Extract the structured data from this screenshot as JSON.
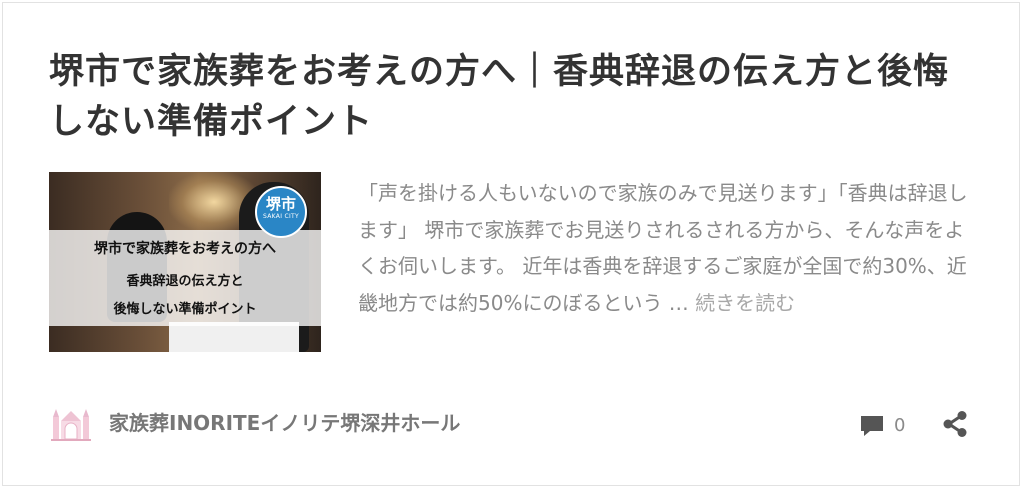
{
  "post": {
    "title": "堺市で家族葬をお考えの方へ｜香典辞退の伝え方と後悔しない準備ポイント",
    "thumbnail": {
      "line1": "堺市で家族葬をお考えの方へ",
      "line2": "香典辞退の伝え方と",
      "line3": "後悔しない準備ポイント",
      "badge_main": "堺市",
      "badge_sub": "SAKAI CITY"
    },
    "excerpt": "「声を掛ける人もいないので家族のみで見送ります」「香典は辞退します」 堺市で家族葬でお見送りされるされる方から、そんな声をよくお伺いします。 近年は香典を辞退するご家庭が全国で約30%、近畿地方では約50%にのぼるという …",
    "read_more": "続きを読む",
    "author": "家族葬INORITEイノリテ堺深井ホール",
    "comment_count": "0"
  },
  "icons": {
    "author": "chapel-logo-icon",
    "comment": "comment-bubble-icon",
    "share": "share-icon"
  },
  "colors": {
    "title": "#333333",
    "excerpt": "#8a8a8a",
    "badge": "#2a86c6",
    "icon": "#555555"
  }
}
